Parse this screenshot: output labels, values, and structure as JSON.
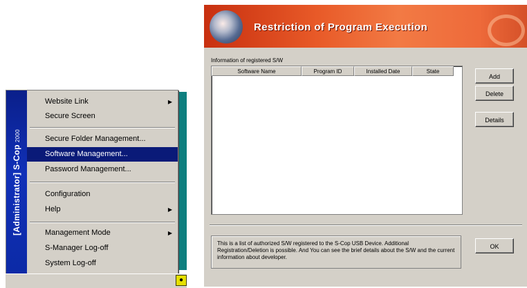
{
  "menu": {
    "banner_main": "[Administrator] S-Cop",
    "banner_small": "2000",
    "items": [
      {
        "label": "Website Link",
        "submenu": true
      },
      {
        "label": "Secure Screen",
        "submenu": false
      },
      {
        "label": "Secure Folder Management...",
        "submenu": false
      },
      {
        "label": "Software Management...",
        "submenu": false,
        "selected": true
      },
      {
        "label": "Password Management...",
        "submenu": false
      },
      {
        "label": "Configuration",
        "submenu": false
      },
      {
        "label": "Help",
        "submenu": true
      },
      {
        "label": "Management Mode",
        "submenu": true
      },
      {
        "label": "S-Manager Log-off",
        "submenu": false
      },
      {
        "label": "System Log-off",
        "submenu": false
      }
    ]
  },
  "dialog": {
    "title": "Restriction of Program Execution",
    "info_label": "Information of registered S/W",
    "columns": [
      "Software Name",
      "Program ID",
      "Installed Date",
      "State"
    ],
    "rows": [],
    "buttons": {
      "add": "Add",
      "delete": "Delete",
      "details": "Details",
      "ok": "OK"
    },
    "description": "This is a list of authorized S/W registered to the S-Cop USB Device. Additional Registration/Deletion is possible. And You can see the brief details about the S/W and the current information about developer."
  },
  "colors": {
    "menu_selection": "#0a1a78",
    "menu_banner": "#1030b8",
    "dialog_banner": "#e85a28",
    "desktop_teal": "#0e7f7f"
  },
  "icons": {
    "submenu_arrow": "triangle-right",
    "tray_icon": "s-cop-tray-icon"
  }
}
